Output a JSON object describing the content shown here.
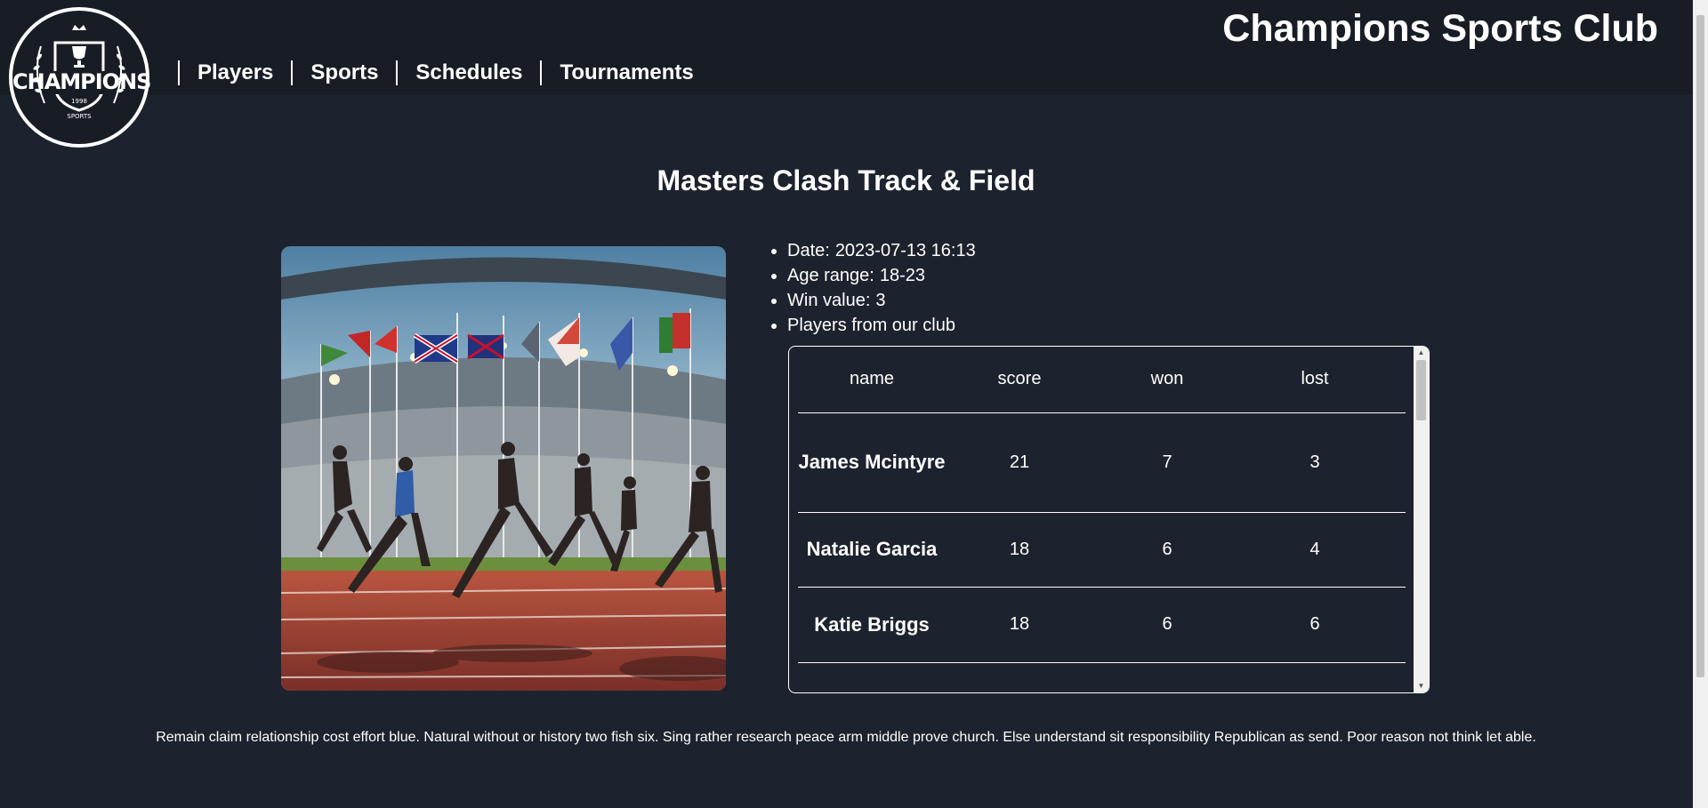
{
  "header": {
    "site_title": "Champions Sports Club",
    "logo": {
      "word": "CHAMPIONS",
      "year": "1998",
      "tagline": "SPORTS"
    },
    "nav": [
      {
        "label": "Players"
      },
      {
        "label": "Sports"
      },
      {
        "label": "Schedules"
      },
      {
        "label": "Tournaments"
      }
    ]
  },
  "tournament": {
    "title": "Masters Clash Track & Field",
    "details": [
      {
        "label": "Date:",
        "value": "2023-07-13 16:13"
      },
      {
        "label": "Age range:",
        "value": "18-23"
      },
      {
        "label": "Win value:",
        "value": "3"
      },
      {
        "label": "Players from our club",
        "value": ""
      }
    ],
    "table": {
      "columns": [
        "name",
        "score",
        "won",
        "lost"
      ],
      "rows": [
        {
          "name": "James Mcintyre",
          "score": "21",
          "won": "7",
          "lost": "3"
        },
        {
          "name": "Natalie Garcia",
          "score": "18",
          "won": "6",
          "lost": "4"
        },
        {
          "name": "Katie Briggs",
          "score": "18",
          "won": "6",
          "lost": "6"
        }
      ]
    },
    "description": "Remain claim relationship cost effort blue. Natural without or history two fish six. Sing rather research peace arm middle prove church. Else understand sit responsibility Republican as send. Poor reason not think let able."
  },
  "colors": {
    "page_bg": "#1d232e",
    "header_bg": "#181d25",
    "text": "#ffffff",
    "track": "#a8493c"
  },
  "icons": {
    "logo": "champions-crest-icon",
    "scroll_up": "triangle-up-icon",
    "scroll_down": "triangle-down-icon"
  }
}
